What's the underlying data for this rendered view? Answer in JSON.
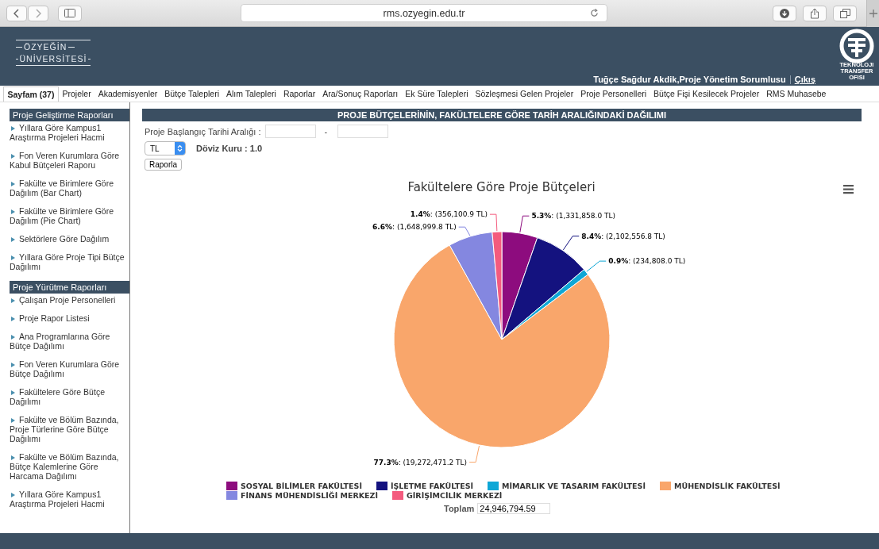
{
  "browser": {
    "url": "rms.ozyegin.edu.tr"
  },
  "header": {
    "logo_lines": [
      "ÖZYEĞİN",
      "ÜNİVERSİTESİ"
    ],
    "tto_lines": [
      "TEKNOLOJI",
      "TRANSFER",
      "OFISI"
    ],
    "user": "Tuğçe Sağdur Akdik,Proje Yönetim Sorumlusu",
    "logout": "Çıkış"
  },
  "nav": [
    {
      "label": "Sayfam (37)",
      "selected": true
    },
    {
      "label": "Projeler",
      "selected": false
    },
    {
      "label": "Akademisyenler",
      "selected": false
    },
    {
      "label": "Bütçe Talepleri",
      "selected": false
    },
    {
      "label": "Alım Talepleri",
      "selected": false
    },
    {
      "label": "Raporlar",
      "selected": false
    },
    {
      "label": "Ara/Sonuç Raporları",
      "selected": false
    },
    {
      "label": "Ek Süre Talepleri",
      "selected": false
    },
    {
      "label": "Sözleşmesi Gelen Projeler",
      "selected": false
    },
    {
      "label": "Proje Personelleri",
      "selected": false
    },
    {
      "label": "Bütçe Fişi Kesilecek Projeler",
      "selected": false
    },
    {
      "label": "RMS Muhasebe",
      "selected": false
    }
  ],
  "sidebar": [
    {
      "title": "Proje Geliştirme Raporları",
      "items": [
        "Yıllara Göre Kampus1 Araştırma Projeleri Hacmi",
        "Fon Veren Kurumlara Göre Kabul Bütçeleri Raporu",
        "Fakülte ve Birimlere Göre Dağılım (Bar Chart)",
        "Fakülte ve Birimlere Göre Dağılım (Pie Chart)",
        "Sektörlere Göre Dağılım",
        "Yıllara Göre Proje Tipi Bütçe Dağılımı"
      ]
    },
    {
      "title": "Proje Yürütme Raporları",
      "items": [
        "Çalışan Proje Personelleri",
        "Proje Rapor Listesi",
        "Ana Programlarına Göre Bütçe Dağılımı",
        "Fon Veren Kurumlara Göre Bütçe Dağılımı",
        "Fakültelere Göre Bütçe Dağılımı",
        "Fakülte ve Bölüm Bazında, Proje Türlerine Göre Bütçe Dağılımı",
        "Fakülte ve Bölüm Bazında, Bütçe Kalemlerine Göre Harcama Dağılımı",
        "Yıllara Göre Kampus1 Araştırma Projeleri Hacmi"
      ]
    }
  ],
  "main": {
    "title": "PROJE BÜTÇELERİNİN, FAKÜLTELERE GÖRE TARİH ARALIĞINDAKİ DAĞILIMI",
    "date_label": "Proje Başlangıç Tarihi Aralığı :",
    "date_separator": "-",
    "currency": "TL",
    "rate": "Döviz Kuru : 1.0",
    "report_button": "Raporla",
    "chart_data": {
      "type": "pie",
      "title": "Fakültelere Göre Proje Bütçeleri",
      "categories": [
        "SOSYAL BİLİMLER FAKÜLTESİ",
        "İŞLETME FAKÜLTESİ",
        "MİMARLIK VE TASARIM FAKÜLTESİ",
        "MÜHENDİSLİK FAKÜLTESİ",
        "FİNANS MÜHENDİSLİĞİ MERKEZİ",
        "GİRİŞİMCİLİK MERKEZİ"
      ],
      "values": [
        1331858.0,
        2102556.8,
        234808.0,
        19272471.2,
        1648999.8,
        356100.9
      ],
      "colors": [
        "#8d0c7e",
        "#14127f",
        "#0ea7d6",
        "#f9a66b",
        "#8487e0",
        "#f45b7e"
      ],
      "value_labels": [
        "**5.3%**: (1,331,858.0 TL)",
        "**8.4%**: (2,102,556.8 TL)",
        "**0.9%**: (234,808.0 TL)",
        "**77.3%**: (19,272,471.2 TL)",
        "**6.6%**: (1,648,999.8 TL)",
        "**1.4%**: (356,100.9 TL)"
      ]
    },
    "total_label": "Toplam",
    "total_value": "24,946,794.59"
  }
}
